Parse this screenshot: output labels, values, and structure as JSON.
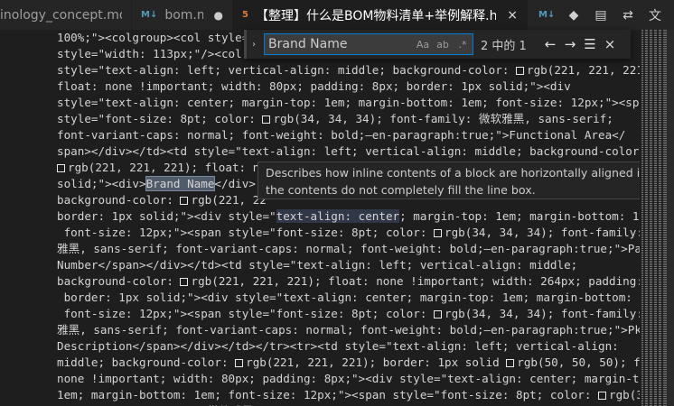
{
  "tabs": [
    {
      "icon": "",
      "label": "inology_concept.md",
      "modified": false
    },
    {
      "icon": "M↓",
      "label": "bom.md",
      "modified": true,
      "modified_mark": "●"
    },
    {
      "icon": "5",
      "label": "【整理】什么是BOM物料清单+举例解释.html",
      "active": true,
      "close": "×"
    },
    {
      "icon": "M↓"
    }
  ],
  "toolbar_icons": [
    "diamond-icon",
    "preview-icon",
    "compare-icon",
    "translate-icon"
  ],
  "find": {
    "toggle": "›",
    "query": "Brand Name",
    "opt_case": "Aa",
    "opt_word": "ab",
    "opt_regex": ".*",
    "count": "2 中的 1",
    "prev": "←",
    "next": "→",
    "selection": "☰",
    "close": "×"
  },
  "tooltip": "Describes how inline contents of a block are horizontally aligned if the contents do not completely fill the line box.",
  "code_lines": [
    {
      "t": "100%;\"><colgroup><col style="
    },
    {
      "t": "style=\"width: 113px;\"/><col"
    },
    {
      "t": "style=\"text-align: left; vertical-align: middle; background-color: ",
      "sw": "rgb(221, 221, 221);"
    },
    {
      "t": "float: none !important; width: 80px; padding: 8px; border: 1px solid;\"><div"
    },
    {
      "t": "style=\"text-align: center; margin-top: 1em; margin-bottom: 1em; font-size: 12px;\"><span"
    },
    {
      "t": "style=\"font-size: 8pt; color: ",
      "sw": "rgb(34, 34, 34); font-family: 微软雅黑, sans-serif;"
    },
    {
      "t": "font-variant-caps: normal; font-weight: bold;–en-paragraph:true;\">Functional Area</"
    },
    {
      "t": "span></div></td><td style=\"text-align: left; vertical-align: middle; background-color:"
    },
    {
      "t": "",
      "sw": "rgb(221, 221, 221); float: none !important; width: 132px; padding: 8px; border: 1px"
    },
    {
      "t": "solid;\"><div>",
      "find": "Brand Name",
      "after": "</div>"
    },
    {
      "t": "background-color: ",
      "sw": "rgb(221, 22"
    },
    {
      "t": "border: 1px solid;\"><div style=\"",
      "hl": "text-align: center",
      "after": "; margin-top: 1em; margin-bottom: 1em;"
    },
    {
      "t": " font-size: 12px;\"><span style=\"font-size: 8pt; color: ",
      "sw": "rgb(34, 34, 34); font-family: 微软"
    },
    {
      "t": "雅黑, sans-serif; font-variant-caps: normal; font-weight: bold;–en-paragraph:true;\">Part"
    },
    {
      "t": "Number</span></div></td><td style=\"text-align: left; vertical-align: middle;"
    },
    {
      "t": "background-color: ",
      "sw": "rgb(221, 221, 221); float: none !important; width: 264px; padding: 8px;"
    },
    {
      "t": " border: 1px solid;\"><div style=\"text-align: center; margin-top: 1em; margin-bottom: 1em;"
    },
    {
      "t": " font-size: 12px;\"><span style=\"font-size: 8pt; color: ",
      "sw": "rgb(34, 34, 34); font-family: 微软"
    },
    {
      "t": "雅黑, sans-serif; font-variant-caps: normal; font-weight: bold;–en-paragraph:true;\">Pkg"
    },
    {
      "t": "Description</span></div></td></tr><tr><td style=\"text-align: left; vertical-align:"
    },
    {
      "t": "middle; background-color: ",
      "sw": "rgb(221, 221, 221); border: 1px solid ",
      "sw2": "rgb(50, 50, 50); float"
    },
    {
      "t": "none !important; width: 80px; padding: 8px;\"><div style=\"text-align: center; margin-top:"
    },
    {
      "t": "1em; margin-bottom: 1em; font-size: 12px;\"><span style=\"font-size: 8pt; color: ",
      "sw": "rgb(34,"
    },
    {
      "t": "34, 34); font-family: 微软雅黑, sans-serif; font-variant-caps: normal; font-weight: bold;"
    }
  ]
}
